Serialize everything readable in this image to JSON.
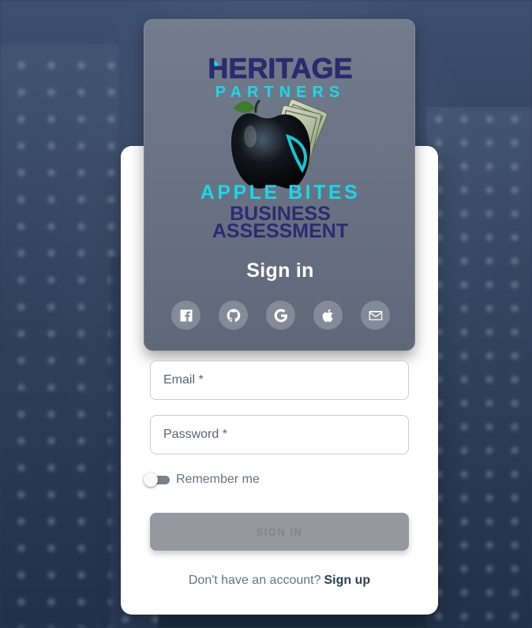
{
  "brand": {
    "line1": "HERITAGE",
    "line2": "PARTNERS",
    "product": "APPLE BITES",
    "subtitle1": "BUSINESS",
    "subtitle2": "ASSESSMENT"
  },
  "header": {
    "title": "Sign in"
  },
  "social": [
    {
      "name": "facebook-icon"
    },
    {
      "name": "github-icon"
    },
    {
      "name": "google-icon"
    },
    {
      "name": "apple-icon"
    },
    {
      "name": "email-icon"
    }
  ],
  "form": {
    "email_placeholder": "Email *",
    "password_placeholder": "Password *",
    "remember_label": "Remember me",
    "remember_checked": false,
    "submit_label": "SIGN IN"
  },
  "footer": {
    "prompt": "Don't have an account?",
    "link": "Sign up"
  },
  "colors": {
    "brand_navy": "#2a2a6e",
    "brand_cyan": "#1ed6e8",
    "link": "#2f3e5a"
  }
}
